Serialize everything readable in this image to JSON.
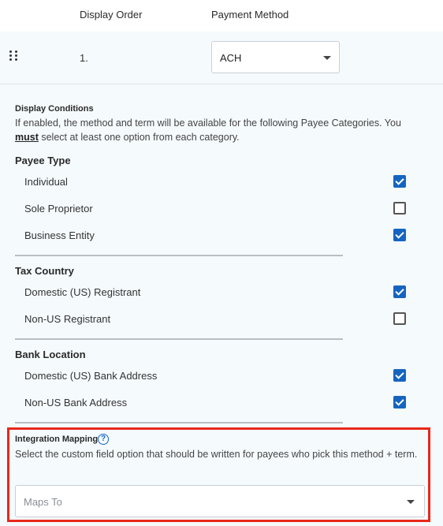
{
  "table": {
    "headers": {
      "display_order": "Display Order",
      "payment_method": "Payment Method"
    },
    "row": {
      "order": "1.",
      "payment_method_value": "ACH"
    }
  },
  "display_conditions": {
    "title": "Display Conditions",
    "desc_before": "If enabled, the method and term will be available for the following Payee Categories. You ",
    "desc_emphasis": "must",
    "desc_after": " select at least one option from each category."
  },
  "sections": {
    "payee_type": {
      "title": "Payee Type",
      "options": [
        {
          "label": "Individual",
          "checked": true
        },
        {
          "label": "Sole Proprietor",
          "checked": false
        },
        {
          "label": "Business Entity",
          "checked": true
        }
      ]
    },
    "tax_country": {
      "title": "Tax Country",
      "options": [
        {
          "label": "Domestic (US) Registrant",
          "checked": true
        },
        {
          "label": "Non-US Registrant",
          "checked": false
        }
      ]
    },
    "bank_location": {
      "title": "Bank Location",
      "options": [
        {
          "label": "Domestic (US) Bank Address",
          "checked": true
        },
        {
          "label": "Non-US Bank Address",
          "checked": true
        }
      ]
    }
  },
  "integration_mapping": {
    "title": "Integration Mapping",
    "help_glyph": "?",
    "description": "Select the custom field option that should be written for payees who pick this method + term.",
    "maps_to_placeholder": "Maps To"
  },
  "colors": {
    "accent": "#1565c0",
    "highlight": "#e8281a",
    "background": "#f5fafd"
  }
}
